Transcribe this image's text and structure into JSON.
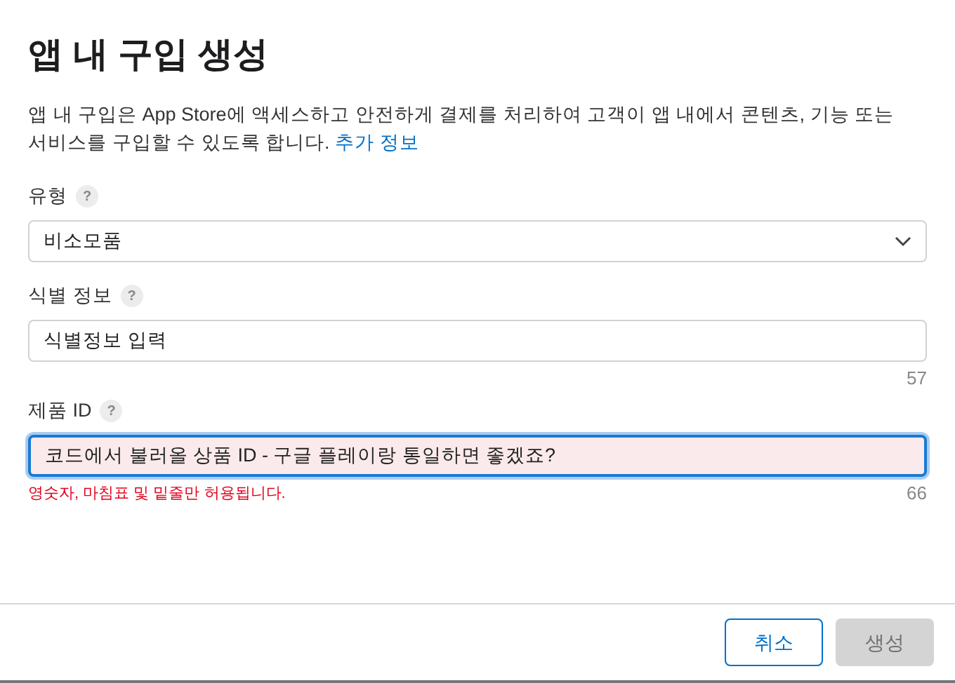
{
  "title": "앱 내 구입 생성",
  "description": {
    "text": "앱 내 구입은 App Store에 액세스하고 안전하게 결제를 처리하여 고객이 앱 내에서 콘텐츠, 기능 또는 서비스를 구입할 수 있도록 합니다.",
    "link": "추가 정보"
  },
  "fields": [
    {
      "kind": "select",
      "label": "유형",
      "help": "?",
      "value": "비소모품"
    },
    {
      "kind": "text",
      "label": "식별 정보",
      "help": "?",
      "value": "식별정보 입력",
      "count": "57",
      "focused": false,
      "invalid": false
    },
    {
      "kind": "text",
      "label": "제품 ID",
      "help": "?",
      "value": "코드에서 불러올 상품 ID - 구글 플레이랑 통일하면 좋겠죠?",
      "count": "66",
      "error": "영숫자, 마침표 및 밑줄만 허용됩니다.",
      "focused": true,
      "invalid": true
    }
  ],
  "buttons": [
    {
      "label": "취소",
      "disabled": false,
      "kind": "secondary"
    },
    {
      "label": "생성",
      "disabled": true,
      "kind": "primary"
    }
  ]
}
